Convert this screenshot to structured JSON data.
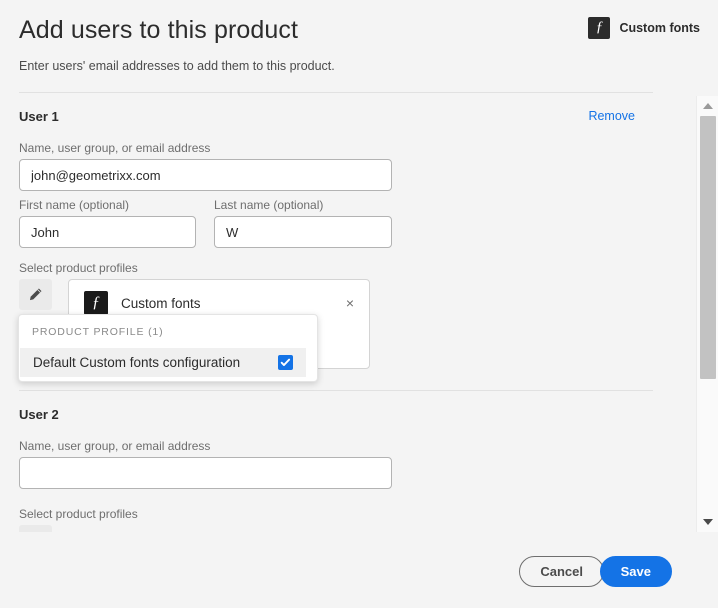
{
  "header": {
    "title": "Add users to this product",
    "subtitle": "Enter users' email addresses to add them to this product.",
    "product_badge": {
      "icon": "custom-fonts-f-icon",
      "glyph": "ƒ",
      "label": "Custom fonts"
    }
  },
  "users": [
    {
      "heading": "User 1",
      "remove_label": "Remove",
      "name_label": "Name, user group, or email address",
      "name_value": "john@geometrixx.com",
      "name_placeholder": "",
      "first_name_label": "First name (optional)",
      "first_name_value": "John",
      "last_name_label": "Last name (optional)",
      "last_name_value": "W",
      "profiles_label": "Select product profiles",
      "edit_icon": "pencil-icon",
      "tag": {
        "icon": "custom-fonts-f-icon",
        "glyph": "ƒ",
        "label": "Custom fonts",
        "close_icon": "close-icon",
        "close_glyph": "×"
      }
    },
    {
      "heading": "User 2",
      "name_label": "Name, user group, or email address",
      "name_value": "",
      "name_placeholder": "",
      "profiles_label": "Select product profiles"
    }
  ],
  "popup": {
    "header": "PRODUCT PROFILE (1)",
    "options": [
      {
        "label": "Default Custom fonts configuration",
        "checked": true,
        "checkbox_icon": "checkmark-icon"
      }
    ]
  },
  "scrollbar": {
    "up_icon": "chevron-up-icon",
    "down_icon": "chevron-down-icon",
    "thumb_label": "scroll-thumb"
  },
  "footer": {
    "cancel_label": "Cancel",
    "save_label": "Save"
  },
  "colors": {
    "background": "#f4f4f4",
    "accent_blue": "#1473e6",
    "text_primary": "#2c2c2c",
    "text_secondary": "#6e6e6e",
    "badge_dark": "#2b2b2b",
    "divider": "#e1e1e1",
    "scroll_thumb": "#c2c2c2"
  }
}
